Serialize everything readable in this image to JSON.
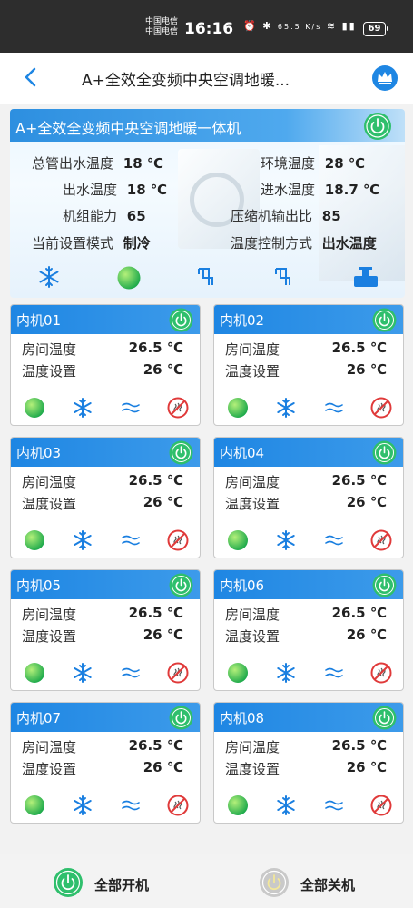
{
  "status_bar": {
    "carrier1": "中国电信",
    "carrier2": "中国电信",
    "time": "16:16",
    "net_speed": "65.5 K/s",
    "battery": "69"
  },
  "header": {
    "title": "A+全效全变频中央空调地暖..."
  },
  "panel": {
    "title": "A+全效全变频中央空调地暖一体机",
    "left": [
      {
        "label": "总管出水温度",
        "value": "18 ℃"
      },
      {
        "label": "出水温度",
        "value": "18 ℃"
      },
      {
        "label": "机组能力",
        "value": "65"
      },
      {
        "label": "当前设置模式",
        "value": "制冷"
      }
    ],
    "right": [
      {
        "label": "环境温度",
        "value": "28 ℃"
      },
      {
        "label": "进水温度",
        "value": "18.7 ℃"
      },
      {
        "label": "压缩机输出比",
        "value": "85"
      },
      {
        "label": "温度控制方式",
        "value": "出水温度"
      }
    ]
  },
  "cards": [
    {
      "name": "内机01",
      "room_label": "房间温度",
      "room_value": "26.5 ℃",
      "set_label": "温度设置",
      "set_value": "26 ℃"
    },
    {
      "name": "内机02",
      "room_label": "房间温度",
      "room_value": "26.5 ℃",
      "set_label": "温度设置",
      "set_value": "26 ℃"
    },
    {
      "name": "内机03",
      "room_label": "房间温度",
      "room_value": "26.5 ℃",
      "set_label": "温度设置",
      "set_value": "26 ℃"
    },
    {
      "name": "内机04",
      "room_label": "房间温度",
      "room_value": "26.5 ℃",
      "set_label": "温度设置",
      "set_value": "26 ℃"
    },
    {
      "name": "内机05",
      "room_label": "房间温度",
      "room_value": "26.5 ℃",
      "set_label": "温度设置",
      "set_value": "26 ℃"
    },
    {
      "name": "内机06",
      "room_label": "房间温度",
      "room_value": "26.5 ℃",
      "set_label": "温度设置",
      "set_value": "26 ℃"
    },
    {
      "name": "内机07",
      "room_label": "房间温度",
      "room_value": "26.5 ℃",
      "set_label": "温度设置",
      "set_value": "26 ℃"
    },
    {
      "name": "内机08",
      "room_label": "房间温度",
      "room_value": "26.5 ℃",
      "set_label": "温度设置",
      "set_value": "26 ℃"
    }
  ],
  "footer": {
    "all_on": "全部开机",
    "all_off": "全部关机"
  },
  "colors": {
    "accent_blue": "#1e86e3",
    "power_green": "#2fbf6c",
    "power_gray": "#c9c9c9",
    "snow_blue": "#1a7fe0",
    "off_red": "#e03a3a"
  }
}
